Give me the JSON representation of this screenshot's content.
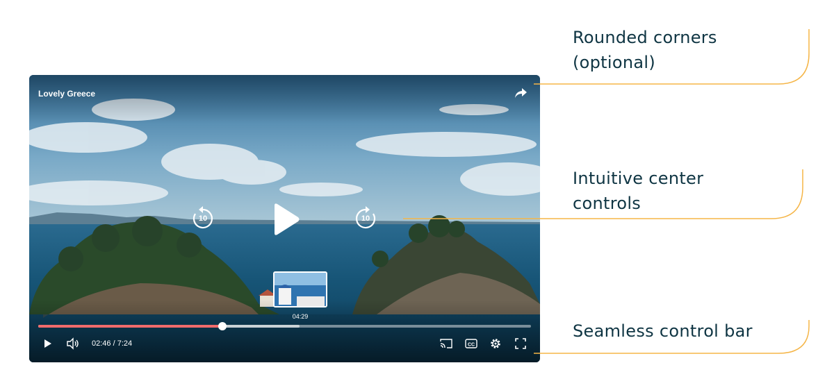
{
  "player": {
    "title": "Lovely Greece",
    "skip_back_seconds": "10",
    "skip_forward_seconds": "10",
    "preview_time": "04:29",
    "current_time": "02:46",
    "separator": "/",
    "duration": "7:24",
    "progress_fraction": 0.3739,
    "buffered_fraction": 0.53,
    "accent_color": "#f06b6b",
    "icons": [
      "share-icon",
      "replay-10-icon",
      "play-icon",
      "forward-10-icon",
      "volume-icon",
      "cast-icon",
      "captions-icon",
      "settings-icon",
      "fullscreen-icon"
    ]
  },
  "annotations": {
    "rounded_corners": {
      "line1": "Rounded corners",
      "line2": "(optional)"
    },
    "center_controls": {
      "line1": "Intuitive center",
      "line2": "controls"
    },
    "control_bar": {
      "line1": "Seamless control bar"
    }
  },
  "annotation_line_color": "#f5b547"
}
